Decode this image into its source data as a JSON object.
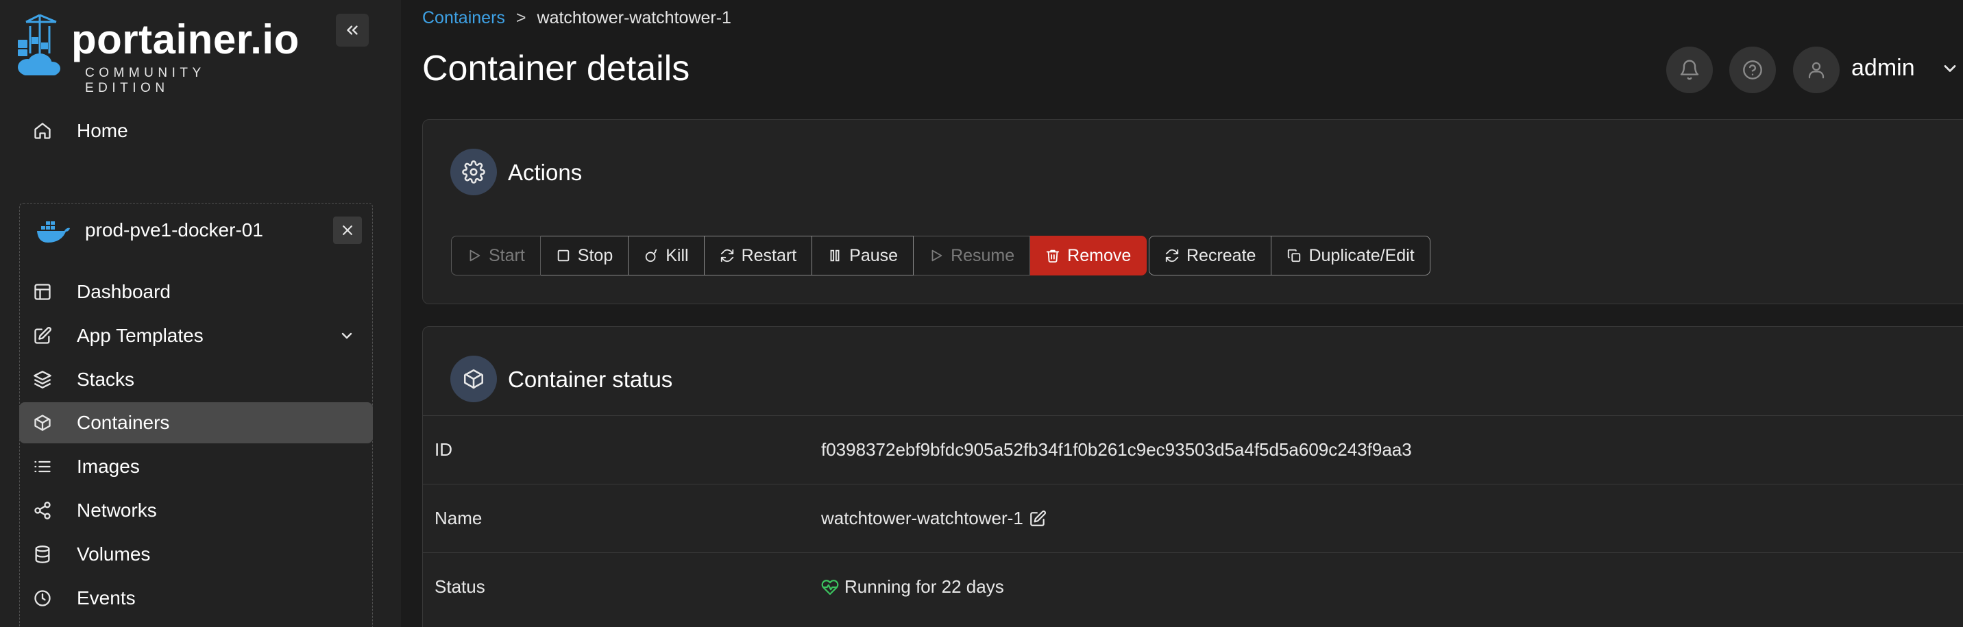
{
  "brand": {
    "name": "portainer.io",
    "edition": "COMMUNITY EDITION"
  },
  "sidebar": {
    "home_label": "Home",
    "environment": {
      "name": "prod-pve1-docker-01"
    },
    "items": [
      {
        "label": "Dashboard",
        "icon": "dashboard-icon"
      },
      {
        "label": "App Templates",
        "icon": "edit-icon"
      },
      {
        "label": "Stacks",
        "icon": "layers-icon"
      },
      {
        "label": "Containers",
        "icon": "box-icon",
        "active": true
      },
      {
        "label": "Images",
        "icon": "list-icon"
      },
      {
        "label": "Networks",
        "icon": "share-icon"
      },
      {
        "label": "Volumes",
        "icon": "database-icon"
      },
      {
        "label": "Events",
        "icon": "clock-icon"
      }
    ]
  },
  "breadcrumb": {
    "link": "Containers",
    "separator": ">",
    "current": "watchtower-watchtower-1"
  },
  "header": {
    "title": "Container details",
    "user": "admin"
  },
  "actions": {
    "title": "Actions",
    "buttons": [
      {
        "label": "Start",
        "icon": "play-icon",
        "disabled": true
      },
      {
        "label": "Stop",
        "icon": "square-icon"
      },
      {
        "label": "Kill",
        "icon": "bomb-icon"
      },
      {
        "label": "Restart",
        "icon": "refresh-icon"
      },
      {
        "label": "Pause",
        "icon": "pause-icon"
      },
      {
        "label": "Resume",
        "icon": "play-icon",
        "disabled": true
      },
      {
        "label": "Remove",
        "icon": "trash-icon",
        "danger": true
      }
    ],
    "buttons2": [
      {
        "label": "Recreate",
        "icon": "refresh-icon"
      },
      {
        "label": "Duplicate/Edit",
        "icon": "copy-icon"
      }
    ]
  },
  "status": {
    "title": "Container status",
    "rows": [
      {
        "key": "ID",
        "value": "f0398372ebf9bfdc905a52fb34f1f0b261c9ec93503d5a4f5d5a609c243f9aa3"
      },
      {
        "key": "Name",
        "value": "watchtower-watchtower-1"
      },
      {
        "key": "Status",
        "value": "Running for 22 days"
      }
    ]
  },
  "colors": {
    "accent": "#3ea2e6",
    "danger": "#c2271c",
    "running": "#3cc35f",
    "sidebar_bg": "#222222",
    "main_bg": "#1b1b1b"
  }
}
